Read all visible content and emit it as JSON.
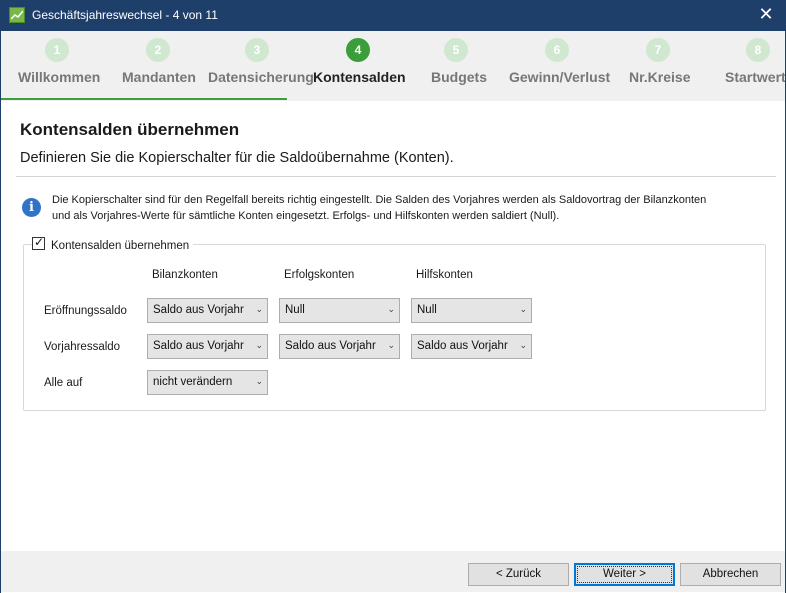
{
  "window": {
    "title": "Geschäftsjahreswechsel - 4 von 11",
    "close_glyph": "✕",
    "app_icon": "chart-icon"
  },
  "steps": [
    {
      "num": "1",
      "label": "Willkommen"
    },
    {
      "num": "2",
      "label": "Mandanten"
    },
    {
      "num": "3",
      "label": "Datensicherung"
    },
    {
      "num": "4",
      "label": "Kontensalden"
    },
    {
      "num": "5",
      "label": "Budgets"
    },
    {
      "num": "6",
      "label": "Gewinn/Verlust"
    },
    {
      "num": "7",
      "label": "Nr.Kreise"
    },
    {
      "num": "8",
      "label": "Startwerte"
    }
  ],
  "active_step": 4,
  "colors": {
    "titlebar": "#1f3f6b",
    "accent_green": "#3a9e3a",
    "step_inactive": "#cfe8cf",
    "info_blue": "#2f74c8"
  },
  "page": {
    "heading": "Kontensalden übernehmen",
    "subheading": "Definieren Sie die Kopierschalter für die Saldoübernahme (Konten).",
    "info_line1": "Die Kopierschalter sind für den Regelfall bereits richtig eingestellt. Die Salden des Vorjahres werden als Saldovortrag der Bilanzkonten",
    "info_line2": "und als Vorjahres-Werte für sämtliche Konten eingesetzt. Erfolgs- und Hilfskonten werden saldiert (Null).",
    "info_icon": "info-icon"
  },
  "group": {
    "checkbox_label": "Kontensalden übernehmen",
    "checked": true,
    "check_glyph": "✓",
    "columns": [
      "Bilanzkonten",
      "Erfolgskonten",
      "Hilfskonten"
    ],
    "rows": [
      {
        "label": "Eröffnungssaldo",
        "values": [
          "Saldo aus Vorjahr",
          "Null",
          "Null"
        ]
      },
      {
        "label": "Vorjahressaldo",
        "values": [
          "Saldo aus Vorjahr",
          "Saldo aus Vorjahr",
          "Saldo aus Vorjahr"
        ]
      },
      {
        "label": "Alle auf",
        "values": [
          "nicht verändern"
        ]
      }
    ],
    "chevron_glyph": "⌄"
  },
  "footer": {
    "back": "< Zurück",
    "next": "Weiter >",
    "cancel": "Abbrechen"
  }
}
